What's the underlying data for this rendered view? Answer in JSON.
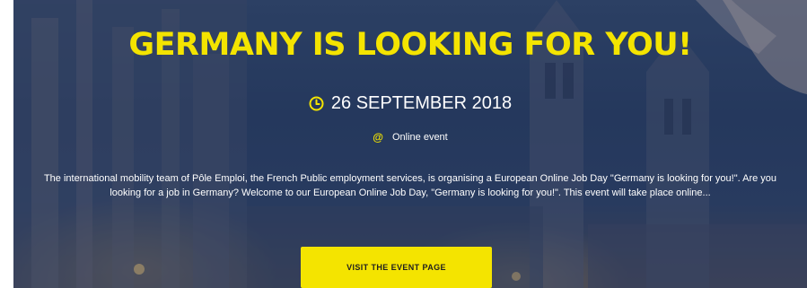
{
  "event": {
    "title": "GERMANY IS LOOKING FOR YOU!",
    "date": "26 SEPTEMBER 2018",
    "location": "Online event",
    "location_symbol": "@",
    "description": "The international mobility team of Pôle Emploi, the French Public employment services, is organising a European Online Job Day \"Germany is looking for you!\". Are you looking for a job in Germany? Welcome to our European Online Job Day, \"Germany is looking for you!\". This event will take place online...",
    "cta_label": "VISIT THE EVENT PAGE"
  },
  "icons": {
    "date": "clock-icon"
  },
  "colors": {
    "accent": "#f4e400",
    "text": "#ffffff",
    "overlay": "#16284e"
  }
}
